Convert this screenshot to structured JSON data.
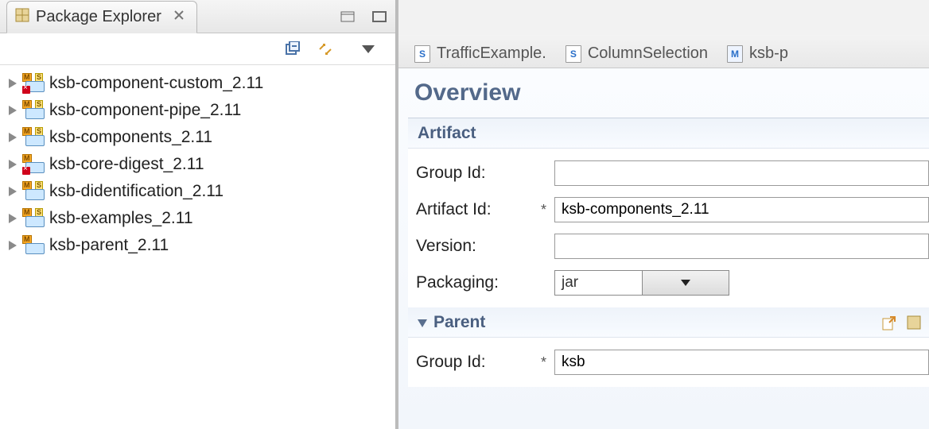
{
  "package_explorer": {
    "title": "Package Explorer",
    "projects": [
      {
        "name": "ksb-component-custom_2.11",
        "error": true
      },
      {
        "name": "ksb-component-pipe_2.11",
        "error": false
      },
      {
        "name": "ksb-components_2.11",
        "error": false
      },
      {
        "name": "ksb-core-digest_2.11",
        "error": true
      },
      {
        "name": "ksb-didentification_2.11",
        "error": false
      },
      {
        "name": "ksb-examples_2.11",
        "error": false
      },
      {
        "name": "ksb-parent_2.11",
        "error": false
      }
    ]
  },
  "editor": {
    "tabs": [
      {
        "label": "TrafficExample.",
        "icon": "S"
      },
      {
        "label": "ColumnSelection",
        "icon": "S"
      },
      {
        "label": "ksb-p",
        "icon": "M"
      }
    ],
    "overview_title": "Overview",
    "artifact_section": {
      "heading": "Artifact",
      "group_id_label": "Group Id:",
      "group_id_value": "",
      "artifact_id_label": "Artifact Id:",
      "artifact_id_value": "ksb-components_2.11",
      "version_label": "Version:",
      "version_value": "",
      "packaging_label": "Packaging:",
      "packaging_value": "jar"
    },
    "parent_section": {
      "heading": "Parent",
      "group_id_label": "Group Id:",
      "group_id_value": "ksb"
    }
  }
}
